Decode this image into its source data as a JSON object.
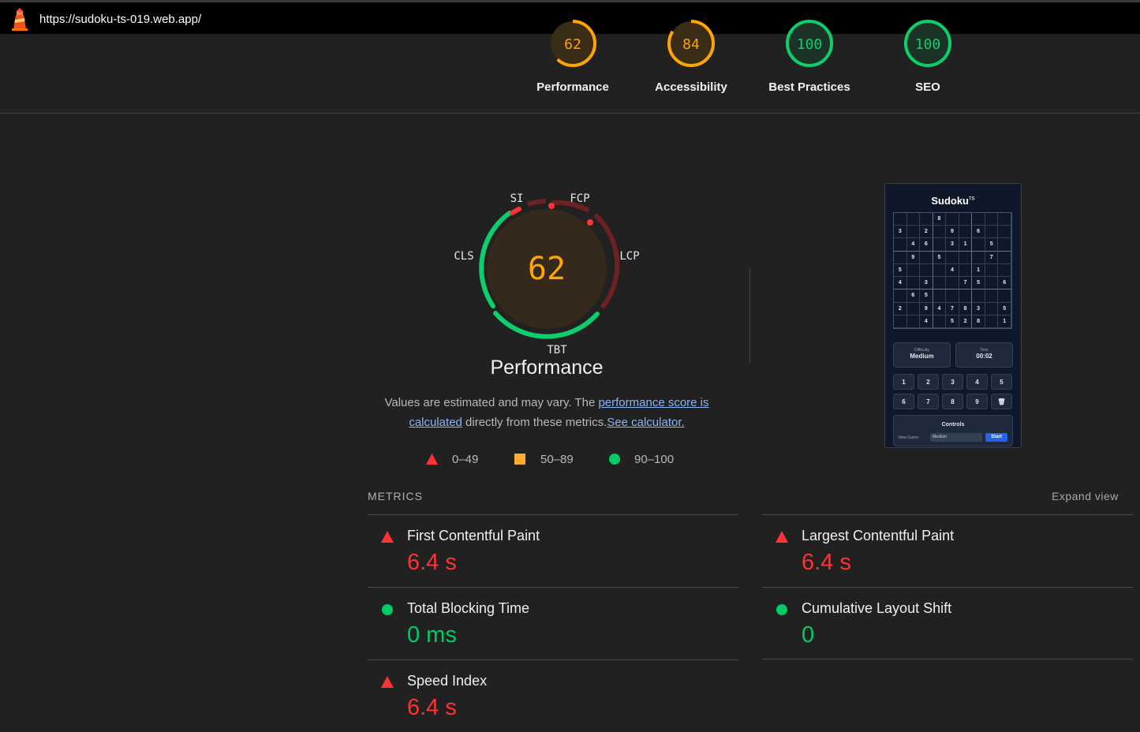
{
  "browser": {
    "url": "https://sudoku-ts-019.web.app/",
    "icon": "lighthouse-icon"
  },
  "categories": [
    {
      "score": "62",
      "label": "Performance",
      "color": "#ffa400",
      "value": 62
    },
    {
      "score": "84",
      "label": "Accessibility",
      "color": "#ffa400",
      "value": 84
    },
    {
      "score": "100",
      "label": "Best Practices",
      "color": "#0cce6b",
      "value": 100
    },
    {
      "score": "100",
      "label": "SEO",
      "color": "#0cce6b",
      "value": 100
    }
  ],
  "main_gauge": {
    "score": "62",
    "title": "Performance",
    "labels": {
      "si": "SI",
      "fcp": "FCP",
      "lcp": "LCP",
      "tbt": "TBT",
      "cls": "CLS"
    }
  },
  "description": {
    "prefix": "Values are estimated and may vary. The ",
    "link1": "performance score is calculated",
    "middle": " directly from these metrics.",
    "link2": "See calculator."
  },
  "legend": {
    "fail": "0–49",
    "average": "50–89",
    "pass": "90–100",
    "colors": {
      "fail": "#ff3333",
      "average": "#ffaa33",
      "pass": "#00cc66"
    }
  },
  "metrics_header": {
    "title": "METRICS",
    "expand": "Expand view"
  },
  "metrics": [
    {
      "name": "First Contentful Paint",
      "value": "6.4 s",
      "status": "fail"
    },
    {
      "name": "Largest Contentful Paint",
      "value": "6.4 s",
      "status": "fail"
    },
    {
      "name": "Total Blocking Time",
      "value": "0 ms",
      "status": "pass"
    },
    {
      "name": "Cumulative Layout Shift",
      "value": "0",
      "status": "pass"
    },
    {
      "name": "Speed Index",
      "value": "6.4 s",
      "status": "fail"
    }
  ],
  "screenshot": {
    "title": "Sudoku",
    "title_sup": "TS",
    "grid": [
      [
        "",
        "",
        "",
        "8",
        "",
        "",
        "",
        "",
        ""
      ],
      [
        "3",
        "",
        "2",
        "",
        "9",
        "",
        "6",
        "",
        ""
      ],
      [
        "",
        "4",
        "6",
        "",
        "3",
        "1",
        "",
        "5",
        ""
      ],
      [
        "",
        "9",
        "",
        "5",
        "",
        "",
        "",
        "7",
        ""
      ],
      [
        "5",
        "",
        "",
        "",
        "4",
        "",
        "1",
        "",
        ""
      ],
      [
        "4",
        "",
        "3",
        "",
        "",
        "7",
        "5",
        "",
        "6"
      ],
      [
        "",
        "6",
        "5",
        "",
        "",
        "",
        "",
        "",
        ""
      ],
      [
        "2",
        "",
        "9",
        "4",
        "7",
        "8",
        "3",
        "",
        "5"
      ],
      [
        "",
        "",
        "4",
        "",
        "5",
        "2",
        "8",
        "",
        "1"
      ]
    ],
    "difficulty_label": "Difficulty",
    "difficulty_value": "Medium",
    "time_label": "Time",
    "time_value": "00:02",
    "keys": [
      "1",
      "2",
      "3",
      "4",
      "5",
      "6",
      "7",
      "8",
      "9",
      "🗑"
    ],
    "controls_title": "Controls",
    "new_game_label": "New Game:",
    "select_value": "Medium",
    "start_label": "Start"
  }
}
